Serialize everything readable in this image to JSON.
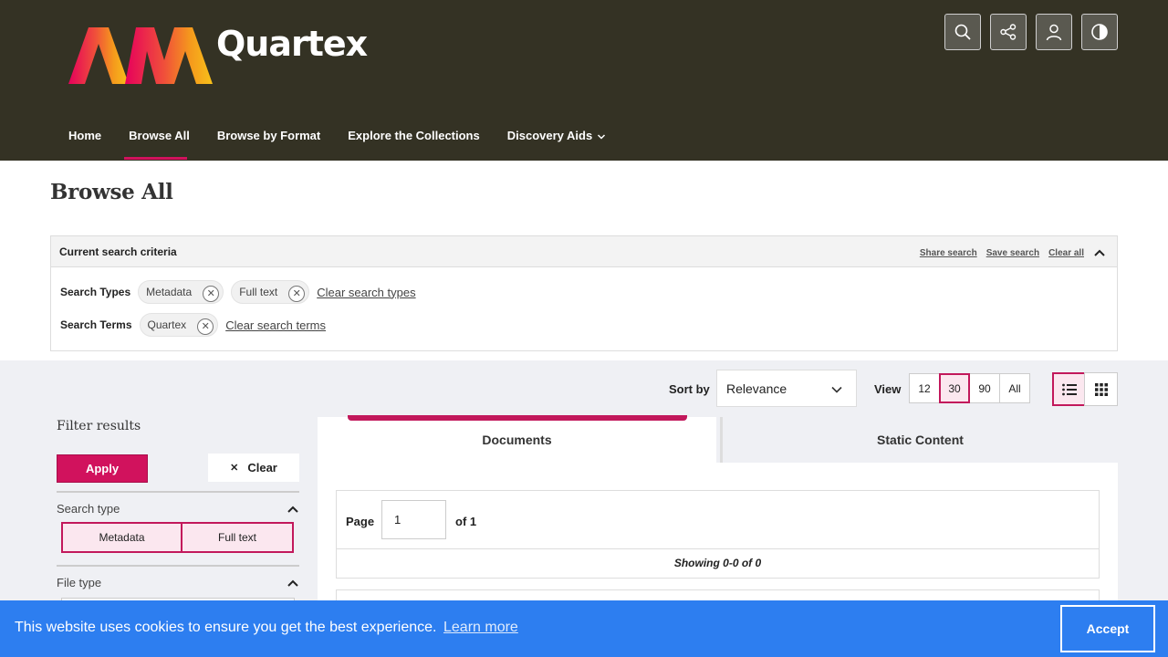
{
  "brand": {
    "name": "Quartex"
  },
  "header_buttons": [
    {
      "icon": "search-icon"
    },
    {
      "icon": "share-icon"
    },
    {
      "icon": "user-icon"
    },
    {
      "icon": "contrast-icon"
    }
  ],
  "nav": {
    "items": [
      "Home",
      "Browse All",
      "Browse by Format",
      "Explore the Collections",
      "Discovery Aids"
    ],
    "active": "Browse All"
  },
  "page": {
    "title": "Browse All"
  },
  "criteria": {
    "title": "Current search criteria",
    "share": "Share search",
    "save": "Save search",
    "clear_all": "Clear all",
    "types_label": "Search Types",
    "types": [
      "Metadata",
      "Full text"
    ],
    "clear_types": "Clear search types",
    "terms_label": "Search Terms",
    "terms": [
      "Quartex"
    ],
    "clear_terms": "Clear search terms"
  },
  "toolbar": {
    "sort_label": "Sort by",
    "sort_value": "Relevance",
    "view_label": "View",
    "view_options": [
      "12",
      "30",
      "90",
      "All"
    ],
    "view_selected": "30",
    "layout_selected": "list"
  },
  "filters": {
    "title": "Filter results",
    "apply": "Apply",
    "clear": "Clear",
    "search_type_label": "Search type",
    "search_types": [
      "Metadata",
      "Full text"
    ],
    "file_type_label": "File type"
  },
  "results": {
    "tabs": [
      "Documents",
      "Static Content"
    ],
    "active_tab": "Documents",
    "page_label": "Page",
    "page_value": "1",
    "of_label": "of 1",
    "showing": "Showing 0-0 of 0"
  },
  "cookie": {
    "message": "This website uses cookies to ensure you get the best experience.",
    "learn_more": "Learn more",
    "accept": "Accept"
  },
  "colors": {
    "header_bg": "#343224",
    "accent": "#d1125d",
    "cookie_bg": "#2d7ef0"
  }
}
